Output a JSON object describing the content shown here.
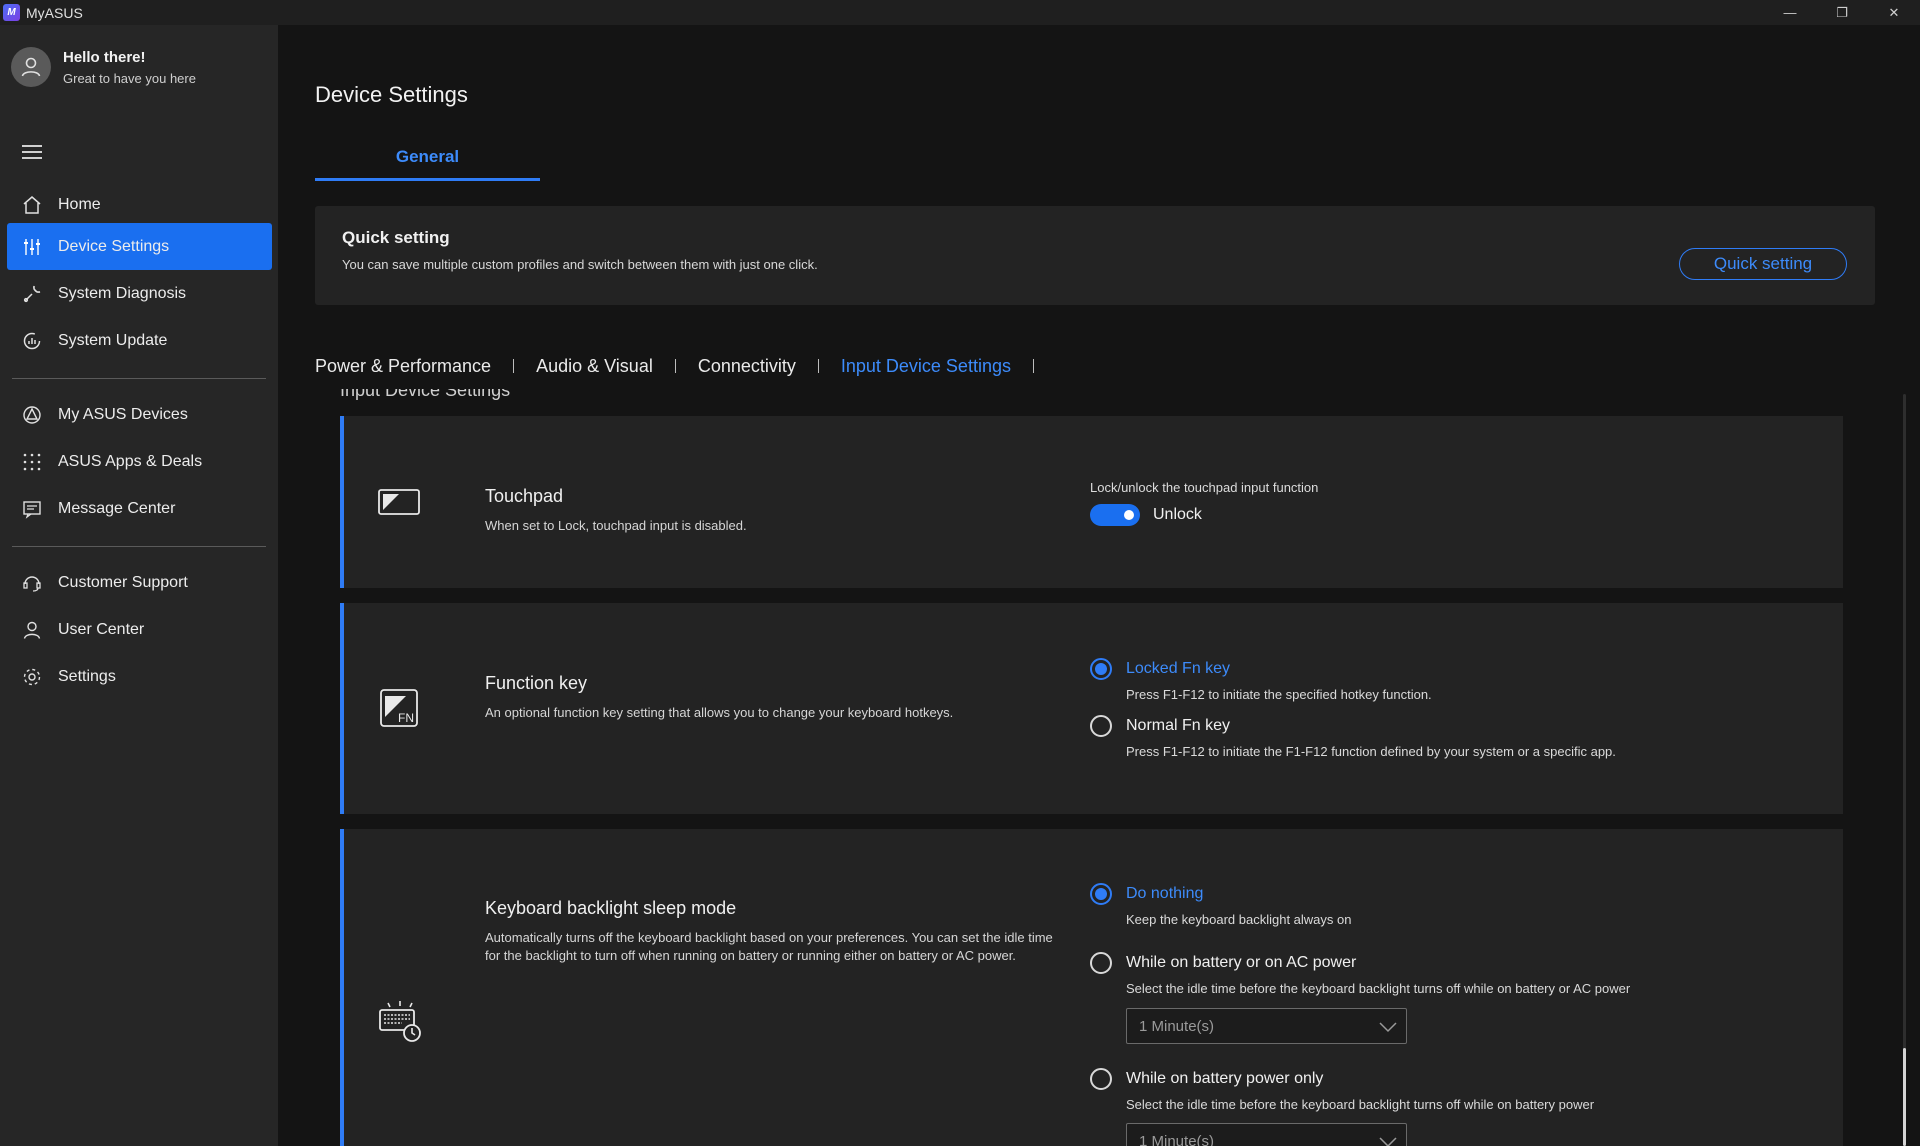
{
  "window": {
    "logo_text": "M",
    "title": "MyASUS",
    "minimize": "—",
    "restore": "❐",
    "close": "✕"
  },
  "user": {
    "greeting": "Hello there!",
    "subtext": "Great to have you here"
  },
  "sidebar": {
    "items": [
      {
        "label": "Home",
        "icon": "home-icon"
      },
      {
        "label": "Device Settings",
        "icon": "sliders-icon",
        "active": true
      },
      {
        "label": "System Diagnosis",
        "icon": "wrench-icon"
      },
      {
        "label": "System Update",
        "icon": "update-icon"
      },
      {
        "label": "My ASUS Devices",
        "icon": "devices-icon"
      },
      {
        "label": "ASUS Apps & Deals",
        "icon": "apps-grid-icon"
      },
      {
        "label": "Message Center",
        "icon": "message-icon"
      },
      {
        "label": "Customer Support",
        "icon": "headset-icon"
      },
      {
        "label": "User Center",
        "icon": "user-icon"
      },
      {
        "label": "Settings",
        "icon": "gear-icon"
      }
    ]
  },
  "main": {
    "title": "Device Settings",
    "tab_general": "General",
    "quick_setting": {
      "title": "Quick setting",
      "description": "You can save multiple custom profiles and switch between them with just one click.",
      "button": "Quick setting"
    },
    "subtabs": [
      "Power & Performance",
      "Audio & Visual",
      "Connectivity",
      "Input Device Settings"
    ],
    "active_subtab": "Input Device Settings",
    "section_title": "Input Device Settings"
  },
  "touchpad": {
    "title": "Touchpad",
    "description": "When set to Lock, touchpad input is disabled.",
    "toggle_caption": "Lock/unlock the touchpad input function",
    "toggle_state": "Unlock",
    "toggle_on": true
  },
  "function_key": {
    "title": "Function key",
    "description": "An optional function key setting that allows you to change your keyboard hotkeys.",
    "options": [
      {
        "label": "Locked Fn key",
        "desc": "Press F1-F12 to initiate the specified hotkey function.",
        "selected": true
      },
      {
        "label": "Normal Fn key",
        "desc": "Press F1-F12 to initiate the F1-F12 function defined by your system or a specific app.",
        "selected": false
      }
    ]
  },
  "backlight": {
    "title": "Keyboard backlight sleep mode",
    "description": "Automatically turns off the keyboard backlight based on your preferences. You can set the idle time for the backlight to turn off when running on battery or running either on battery or AC power.",
    "options": [
      {
        "label": "Do nothing",
        "desc": "Keep the keyboard backlight always on",
        "selected": true
      },
      {
        "label": "While on battery or on AC power",
        "desc": "Select the idle time before the keyboard backlight turns off while on battery or AC power",
        "selected": false,
        "dropdown": "1 Minute(s)"
      },
      {
        "label": "While on battery power only",
        "desc": "Select the idle time before the keyboard backlight turns off while on battery power",
        "selected": false,
        "dropdown": "1 Minute(s)"
      }
    ]
  },
  "colors": {
    "accent": "#2f7cf6",
    "sidebar_bg": "#262626",
    "main_bg": "#141414",
    "card_bg": "#232323"
  }
}
